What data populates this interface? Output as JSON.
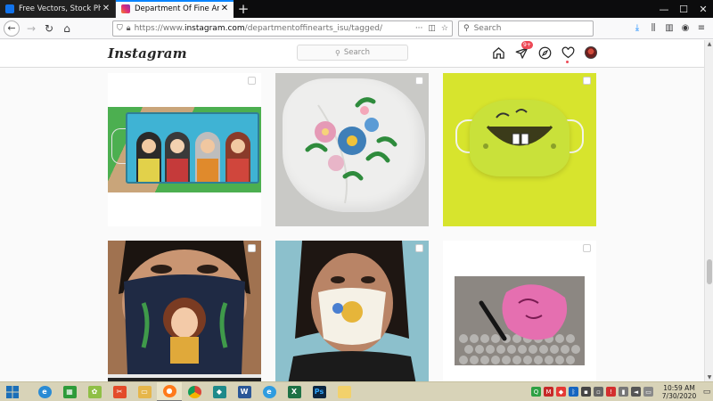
{
  "browser": {
    "tabs": [
      {
        "title": "Free Vectors, Stock Photos & P",
        "active": false,
        "favicon_color": "#1273eb"
      },
      {
        "title": "Department Of Fine Arts (@de",
        "active": true,
        "favicon_color": "#c13584"
      }
    ],
    "url_prefix": "https://www.",
    "url_domain": "instagram.com",
    "url_path": "/departmentoffinearts_isu/tagged/",
    "search_placeholder": "Search",
    "overflow_label": "···"
  },
  "instagram": {
    "logo": "Instagram",
    "search_placeholder": "Search",
    "notification_badge": "9+"
  },
  "taskbar": {
    "clock_time": "10:59 AM",
    "clock_date": "7/30/2020",
    "apps": [
      {
        "name": "windows-start",
        "color": "#1b6fb8"
      },
      {
        "name": "internet-explorer",
        "color": "#2a8bd4"
      },
      {
        "name": "store",
        "color": "#2e9b3a"
      },
      {
        "name": "sprout",
        "color": "#8fbf46"
      },
      {
        "name": "snip",
        "color": "#e34b2a"
      },
      {
        "name": "file-explorer",
        "color": "#e6b64a"
      },
      {
        "name": "firefox",
        "color": "#ff7a1a"
      },
      {
        "name": "chrome",
        "color": "#3a9a45"
      },
      {
        "name": "filmora",
        "color": "#1f8a8a"
      },
      {
        "name": "word",
        "color": "#2b5797"
      },
      {
        "name": "edge",
        "color": "#2f9ce0"
      },
      {
        "name": "excel",
        "color": "#1e7145"
      },
      {
        "name": "photoshop",
        "color": "#0b2540"
      },
      {
        "name": "folder",
        "color": "#f2d16b"
      }
    ],
    "tray_letters": {
      "q": "Q",
      "m": "M",
      "ps": "Ps"
    }
  }
}
